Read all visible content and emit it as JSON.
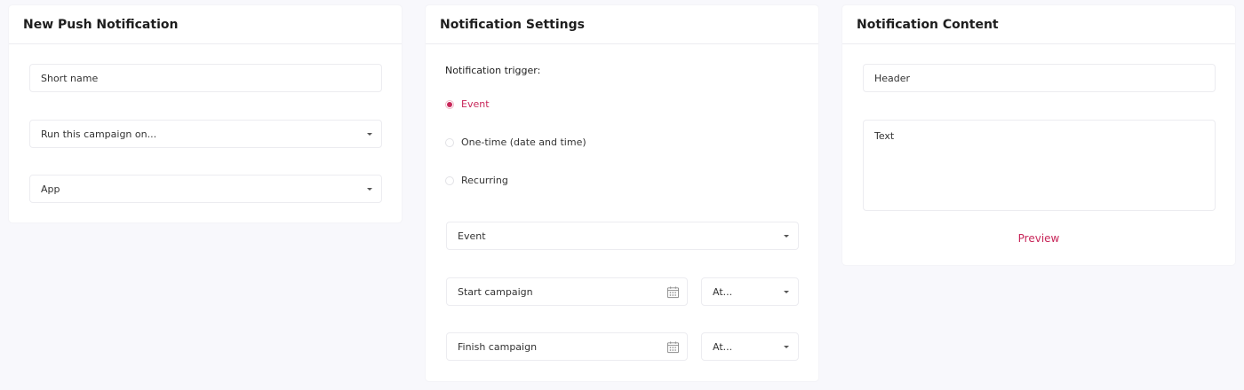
{
  "colors": {
    "accent": "#c8275a",
    "background": "#f8f8fc",
    "card": "#ffffff",
    "border": "#ececf0"
  },
  "panel_left": {
    "title": "New Push Notification",
    "short_name_placeholder": "Short name",
    "campaign_select": "Run this campaign on...",
    "platform_select": "App"
  },
  "panel_middle": {
    "title": "Notification Settings",
    "trigger_label": "Notification trigger:",
    "trigger_options": [
      {
        "label": "Event",
        "selected": true
      },
      {
        "label": "One-time (date and time)",
        "selected": false
      },
      {
        "label": "Recurring",
        "selected": false
      }
    ],
    "event_select": "Event",
    "start_campaign": "Start campaign",
    "start_time_select": "At...",
    "finish_campaign": "Finish campaign",
    "finish_time_select": "At...",
    "calendar_icon": "calendar-icon"
  },
  "panel_right": {
    "title": "Notification Content",
    "header_placeholder": "Header",
    "text_placeholder": "Text",
    "preview_label": "Preview"
  }
}
